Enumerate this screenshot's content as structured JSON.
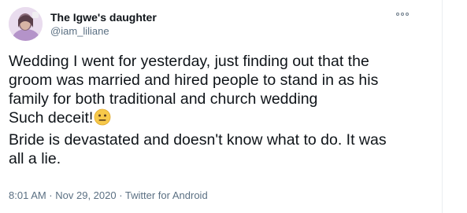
{
  "user": {
    "display_name": "The Igwe's daughter",
    "handle": "@iam_liliane",
    "avatar_icon": "profile-photo"
  },
  "menu": {
    "icon": "more-options-icon"
  },
  "tweet": {
    "lines": [
      "Wedding I went for yesterday, just finding out that the",
      "groom was married and hired people to stand in as his",
      "family for both traditional and church wedding",
      "Such deceit!",
      "Bride is devastated and doesn't know what to do. It was",
      "all a lie."
    ],
    "emoji": "neutral-face-emoji"
  },
  "meta": {
    "timestamp": "8:01 AM · Nov 29, 2020 · Twitter for Android"
  },
  "colors": {
    "text": "#0f1419",
    "secondary": "#5b7083",
    "emoji_yellow": "#f7c94a"
  }
}
